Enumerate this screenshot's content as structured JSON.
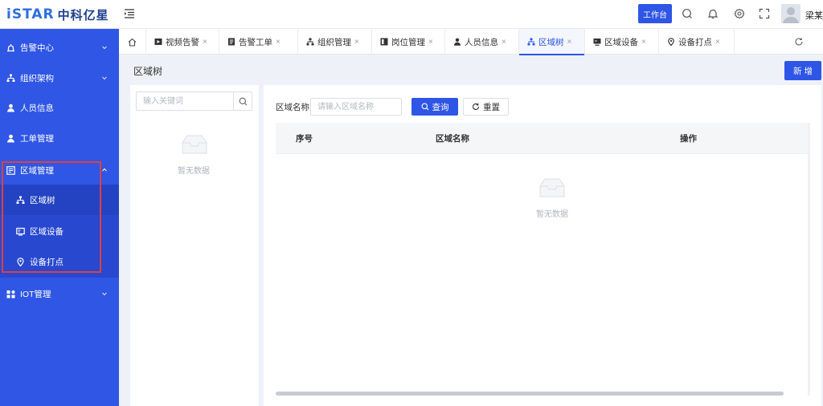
{
  "header": {
    "logo_latin": "iSTAR",
    "logo_cn": "中科亿星",
    "workbench_label": "工作台",
    "username": "梁某"
  },
  "sidebar": {
    "items": [
      {
        "label": "告警中心",
        "icon": "alarm-icon"
      },
      {
        "label": "组织架构",
        "icon": "org-icon"
      },
      {
        "label": "人员信息",
        "icon": "person-icon"
      },
      {
        "label": "工单管理",
        "icon": "worker-icon"
      },
      {
        "label": "区域管理",
        "icon": "region-icon"
      },
      {
        "label": "IOT管理",
        "icon": "iot-icon"
      }
    ],
    "sub_items": [
      {
        "label": "区域树",
        "icon": "tree-icon"
      },
      {
        "label": "区域设备",
        "icon": "device-icon"
      },
      {
        "label": "设备打点",
        "icon": "location-pin-icon"
      }
    ]
  },
  "tabs": [
    {
      "label": "视频告警"
    },
    {
      "label": "告警工单"
    },
    {
      "label": "组织管理"
    },
    {
      "label": "岗位管理"
    },
    {
      "label": "人员信息"
    },
    {
      "label": "区域树"
    },
    {
      "label": "区域设备"
    },
    {
      "label": "设备打点"
    }
  ],
  "tab_close": "×",
  "page": {
    "title": "区域树",
    "add_label": "新 增"
  },
  "tree": {
    "search_placeholder": "输入关键词",
    "empty_text": "暂无数据"
  },
  "filter": {
    "label": "区域名称",
    "placeholder": "请输入区域名称",
    "query_label": "查询",
    "reset_label": "重置"
  },
  "table": {
    "columns": [
      "序号",
      "区域名称",
      "操作"
    ],
    "empty_text": "暂无数据"
  },
  "colors": {
    "accent": "#2f55e6",
    "sidebar": "#2f56e4",
    "highlight": "#e0403f"
  }
}
